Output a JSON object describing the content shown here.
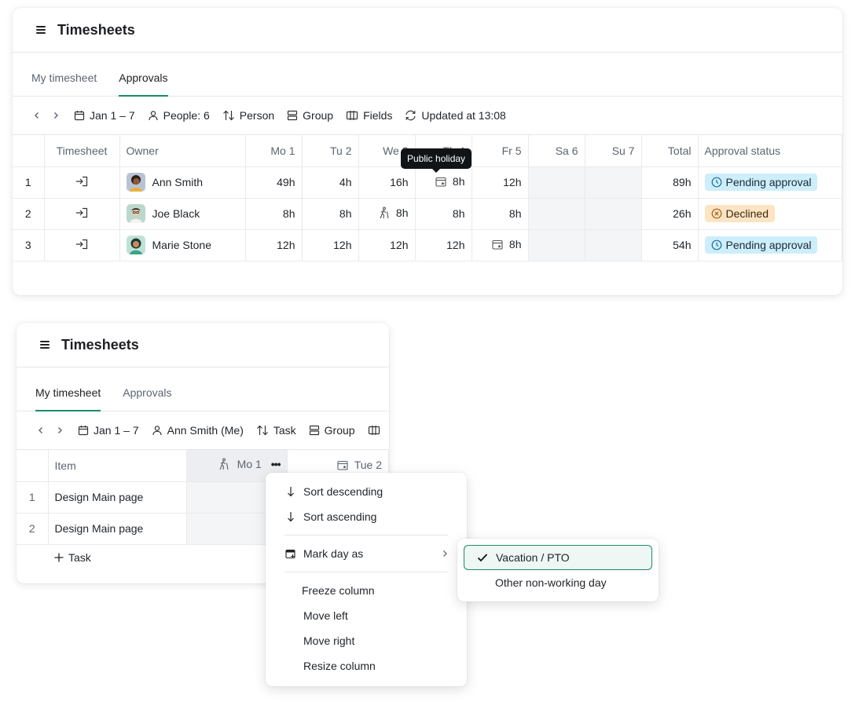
{
  "top": {
    "title": "Timesheets",
    "tabs": [
      "My timesheet",
      "Approvals"
    ],
    "toolbar": {
      "date_range": "Jan 1 – 7",
      "people": "People: 6",
      "sort": "Person",
      "group": "Group",
      "fields": "Fields",
      "updated": "Updated at 13:08"
    },
    "columns": [
      "Timesheet",
      "Owner",
      "Mo 1",
      "Tu 2",
      "We 3",
      "Th 4",
      "Fr 5",
      "Sa 6",
      "Su 7",
      "Total",
      "Approval status"
    ],
    "rows": [
      {
        "num": "1",
        "owner": "Ann Smith",
        "mo": "49h",
        "tu": "4h",
        "we": "16h",
        "th": "8h",
        "fr": "12h",
        "total": "89h",
        "status": "Pending approval"
      },
      {
        "num": "2",
        "owner": "Joe Black",
        "mo": "8h",
        "tu": "8h",
        "we": "8h",
        "th": "8h",
        "fr": "8h",
        "total": "26h",
        "status": "Declined"
      },
      {
        "num": "3",
        "owner": "Marie Stone",
        "mo": "12h",
        "tu": "12h",
        "we": "12h",
        "th": "12h",
        "fr": "8h",
        "total": "54h",
        "status": "Pending approval"
      }
    ],
    "tooltip": "Public holiday"
  },
  "bottom": {
    "title": "Timesheets",
    "tabs": [
      "My timesheet",
      "Approvals"
    ],
    "toolbar": {
      "date_range": "Jan 1 – 7",
      "person": "Ann Smith (Me)",
      "sort": "Task",
      "group": "Group"
    },
    "columns": [
      "Item",
      "Mo 1",
      "Tue 2"
    ],
    "rows": [
      {
        "num": "1",
        "item": "Design Main page"
      },
      {
        "num": "2",
        "item": "Design Main page"
      }
    ],
    "add_task": "Task"
  },
  "context_menu": {
    "sort_desc": "Sort descending",
    "sort_asc": "Sort ascending",
    "mark_day": "Mark day as",
    "freeze": "Freeze column",
    "move_left": "Move left",
    "move_right": "Move right",
    "resize": "Resize column"
  },
  "submenu": {
    "vacation": "Vacation / PTO",
    "other": "Other non-working day"
  },
  "colors": {
    "accent": "#1a8a6b",
    "pending_bg": "#cdeefb",
    "declined_bg": "#fde4c2",
    "weekend_bg": "#f4f5f6",
    "tooltip_bg": "#111417"
  }
}
